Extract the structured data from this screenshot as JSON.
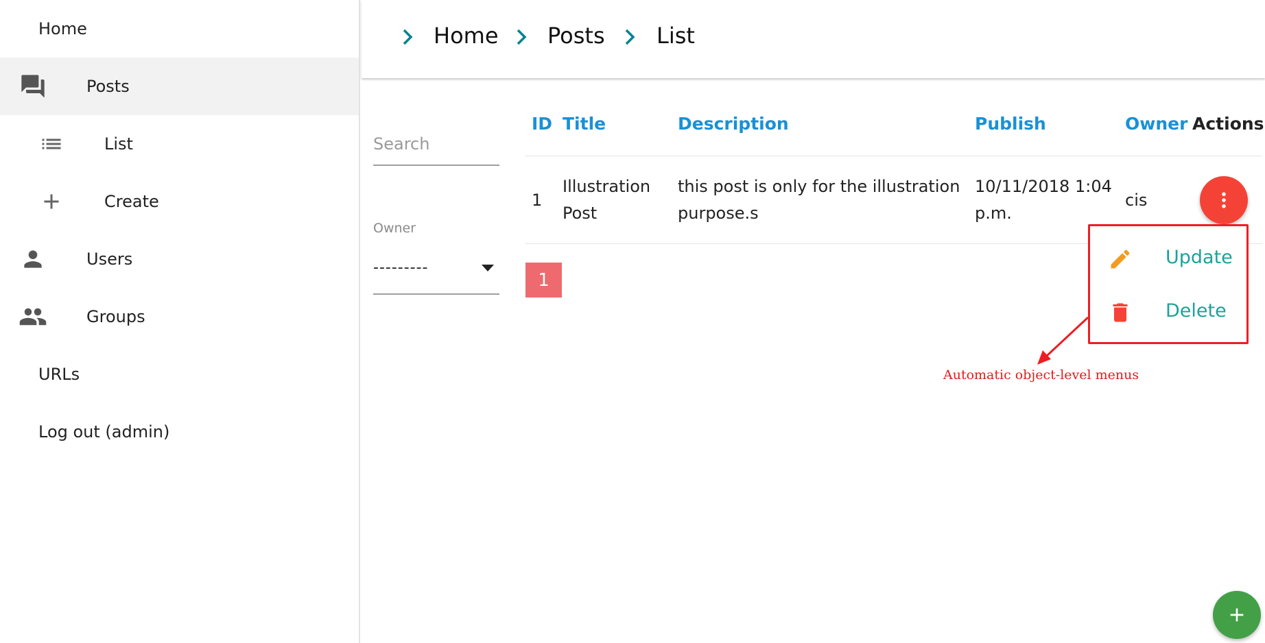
{
  "sidebar": {
    "items": [
      {
        "label": "Home"
      },
      {
        "label": "Posts",
        "icon": "forum-icon"
      },
      {
        "label": "List",
        "icon": "list-icon"
      },
      {
        "label": "Create",
        "icon": "plus-icon"
      },
      {
        "label": "Users",
        "icon": "person-icon"
      },
      {
        "label": "Groups",
        "icon": "group-icon"
      },
      {
        "label": "URLs"
      },
      {
        "label": "Log out (admin)"
      }
    ]
  },
  "breadcrumb": [
    "Home",
    "Posts",
    "List"
  ],
  "filters": {
    "search_placeholder": "Search",
    "owner_label": "Owner",
    "owner_value": "---------"
  },
  "table": {
    "columns": [
      "ID",
      "Title",
      "Description",
      "Publish",
      "Owner",
      "Actions"
    ],
    "rows": [
      {
        "id": "1",
        "title_line1": "Illustration",
        "title_line2": "Post",
        "description_line1": "this post is only for the illustration",
        "description_line2": "purpose.s",
        "publish_line1": "10/11/2018 1:04",
        "publish_line2": "p.m.",
        "owner": "cis"
      }
    ]
  },
  "pagination": {
    "current_page": "1"
  },
  "menu": {
    "update_label": "Update",
    "delete_label": "Delete"
  },
  "annotation": "Automatic object-level menus",
  "colors": {
    "accent_link": "#1a90d6",
    "breadcrumb_chevron": "#00838f",
    "danger_fab": "#f44336",
    "add_fab": "#43a047",
    "menu_text": "#1aa39a",
    "annotation_red": "#ee1d23"
  }
}
